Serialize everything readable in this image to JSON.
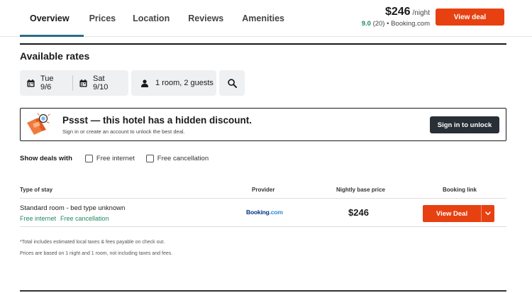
{
  "nav": {
    "tabs": [
      {
        "label": "Overview",
        "active": true
      },
      {
        "label": "Prices",
        "active": false
      },
      {
        "label": "Location",
        "active": false
      },
      {
        "label": "Reviews",
        "active": false
      },
      {
        "label": "Amenities",
        "active": false
      }
    ],
    "price": "$246",
    "price_unit": "/night",
    "rating_score": "9.0",
    "rating_rest": "(20) • Booking.com",
    "view_deal_label": "View deal"
  },
  "rates": {
    "title": "Available rates",
    "checkin": "Tue 9/6",
    "checkout": "Sat 9/10",
    "guests": "1 room, 2 guests"
  },
  "banner": {
    "title": "Pssst — this hotel has a hidden discount.",
    "subtitle": "Sign in or create an account to unlock the best deal.",
    "button": "Sign in to unlock"
  },
  "filters": {
    "label": "Show deals with",
    "options": [
      {
        "label": "Free internet",
        "checked": false
      },
      {
        "label": "Free cancellation",
        "checked": false
      }
    ]
  },
  "table": {
    "headers": [
      "Type of stay",
      "Provider",
      "Nightly base price",
      "Booking link"
    ],
    "rows": [
      {
        "room": "Standard room - bed type unknown",
        "amenities": [
          "Free internet",
          "Free cancellation"
        ],
        "provider_main": "Booking",
        "provider_suffix": ".com",
        "price": "$246",
        "action": "View Deal"
      }
    ]
  },
  "footnotes": [
    "*Total includes estimated local taxes & fees payable on check out.",
    "Prices are based on 1 night and 1 room, not including taxes and fees."
  ],
  "colors": {
    "accent": "#e74112",
    "dark_button": "#292f36",
    "green": "#1f8a5f",
    "tab_underline": "#2a6f81"
  },
  "icons": [
    "calendar-icon",
    "person-icon",
    "search-icon",
    "chevron-down-icon",
    "discount-illustration"
  ]
}
